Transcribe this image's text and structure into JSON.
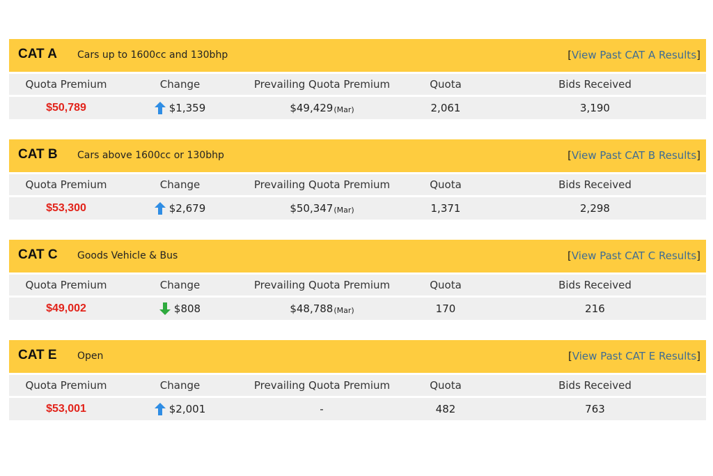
{
  "colors": {
    "header_bg": "#fecc3f",
    "row_bg": "#efefef",
    "premium_text": "#e2231a",
    "link_text": "#3f6d93",
    "arrow_up": "#2f8de4",
    "arrow_down": "#2eaa3e"
  },
  "columns": {
    "quota_premium": "Quota Premium",
    "change": "Change",
    "prevailing": "Prevailing Quota Premium",
    "quota": "Quota",
    "bids": "Bids Received"
  },
  "categories": [
    {
      "code": "CAT A",
      "description": "Cars up to 1600cc and 130bhp",
      "link_open": "[",
      "link_label": "View Past CAT A Results",
      "link_close": "]",
      "quota_premium": "$50,789",
      "change_direction": "up",
      "change_icon": "arrow-up-icon",
      "change": "$1,359",
      "prevailing": "$49,429",
      "prevailing_month": "(Mar)",
      "quota": "2,061",
      "bids": "3,190"
    },
    {
      "code": "CAT B",
      "description": "Cars above 1600cc or 130bhp",
      "link_open": "[",
      "link_label": "View Past CAT B Results",
      "link_close": "]",
      "quota_premium": "$53,300",
      "change_direction": "up",
      "change_icon": "arrow-up-icon",
      "change": "$2,679",
      "prevailing": "$50,347",
      "prevailing_month": "(Mar)",
      "quota": "1,371",
      "bids": "2,298"
    },
    {
      "code": "CAT C",
      "description": "Goods Vehicle & Bus",
      "link_open": "[",
      "link_label": "View Past CAT C Results",
      "link_close": "]",
      "quota_premium": "$49,002",
      "change_direction": "down",
      "change_icon": "arrow-down-icon",
      "change": "$808",
      "prevailing": "$48,788",
      "prevailing_month": "(Mar)",
      "quota": "170",
      "bids": "216"
    },
    {
      "code": "CAT E",
      "description": "Open",
      "link_open": "[",
      "link_label": "View Past CAT E Results",
      "link_close": "]",
      "quota_premium": "$53,001",
      "change_direction": "up",
      "change_icon": "arrow-up-icon",
      "change": "$2,001",
      "prevailing": "-",
      "prevailing_month": "",
      "quota": "482",
      "bids": "763"
    }
  ]
}
